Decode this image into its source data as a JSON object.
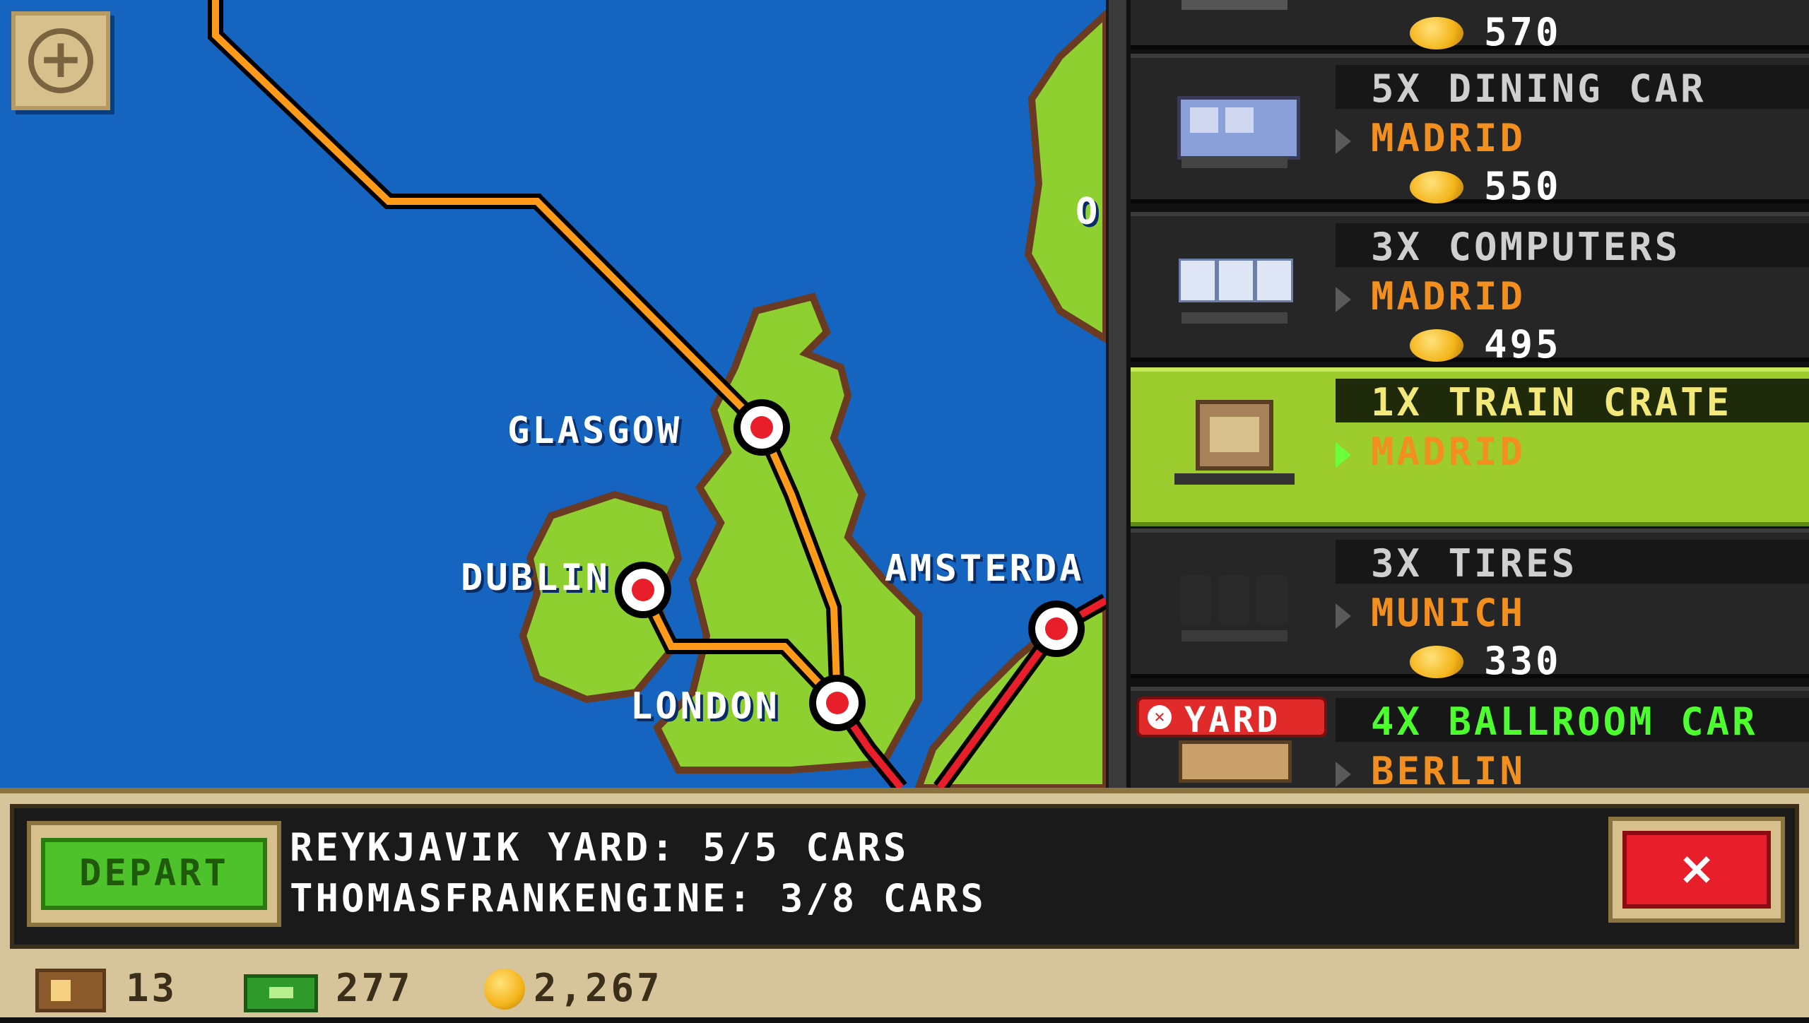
{
  "map": {
    "zoom_button_icon": "plus-icon",
    "cities": [
      "GLASGOW",
      "DUBLIN",
      "LONDON",
      "AMSTERDA"
    ],
    "edge_letter": "O",
    "colors": {
      "sea": "#1565c0",
      "land": "#8ed030",
      "route_orange": "#ff9a1a",
      "route_red": "#e81f2a"
    }
  },
  "cargo": {
    "items": [
      {
        "name": "",
        "destination": "",
        "price": "570",
        "icon": "passenger-car-icon",
        "selected": false
      },
      {
        "name": "5X DINING CAR",
        "destination": "MADRID",
        "price": "550",
        "icon": "dining-car-icon",
        "selected": false
      },
      {
        "name": "3X COMPUTERS",
        "destination": "MADRID",
        "price": "495",
        "icon": "computers-icon",
        "selected": false
      },
      {
        "name": "1X TRAIN CRATE",
        "destination": "MADRID",
        "price": "",
        "icon": "train-crate-icon",
        "selected": true
      },
      {
        "name": "3X TIRES",
        "destination": "MUNICH",
        "price": "330",
        "icon": "tires-icon",
        "selected": false
      },
      {
        "name": "4X BALLROOM CAR",
        "destination": "BERLIN",
        "price": "",
        "icon": "ballroom-car-icon",
        "selected": false,
        "badge": "YARD"
      }
    ]
  },
  "bottom": {
    "depart_label": "DEPART",
    "message_line1": "REYKJAVIK YARD: 5/5 CARS",
    "message_line2": "THOMASFRANKENGINE: 3/8 CARS",
    "close_label": "×"
  },
  "stats": {
    "crates": "13",
    "cash": "277",
    "coins": "2,267"
  }
}
